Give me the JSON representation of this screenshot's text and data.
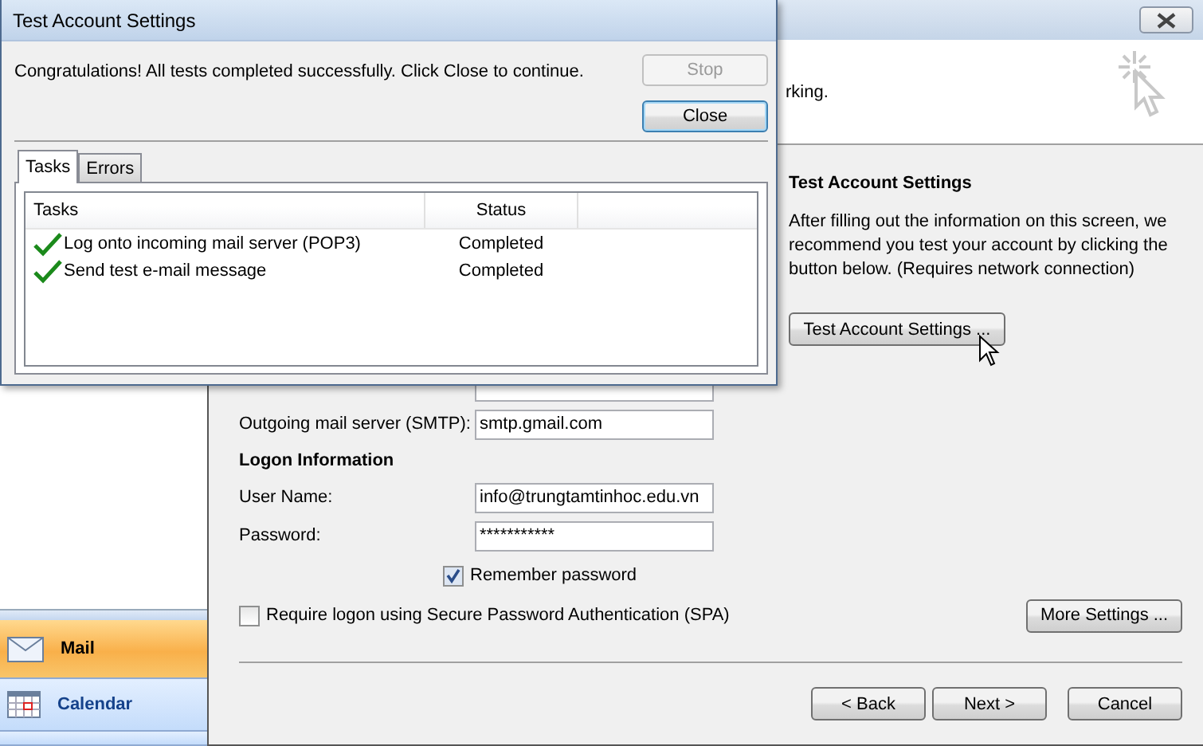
{
  "dialog": {
    "title": "Test Account Settings",
    "message": "Congratulations! All tests completed successfully. Click Close to continue.",
    "buttons": [
      {
        "label": "Stop",
        "disabled": true
      },
      {
        "label": "Close",
        "disabled": false
      }
    ],
    "tabs": [
      {
        "label": "Tasks",
        "selected": true
      },
      {
        "label": "Errors",
        "selected": false
      }
    ],
    "table": {
      "columns": [
        "Tasks",
        "Status"
      ],
      "rows": [
        {
          "task": "Log onto incoming mail server (POP3)",
          "status": "Completed",
          "done": true
        },
        {
          "task": "Send test e-mail message",
          "status": "Completed",
          "done": true
        }
      ]
    }
  },
  "wizard": {
    "header_text": "rking.",
    "section_title": "Test Account Settings",
    "description": "After filling out the information on this screen, we recommend you test your account by clicking the button below. (Requires network connection)",
    "test_button": "Test Account Settings ...",
    "server_fields": [
      {
        "label": "Outgoing mail server (SMTP):",
        "value": "smtp.gmail.com"
      }
    ],
    "logon_title": "Logon Information",
    "logon_fields": [
      {
        "label": "User Name:",
        "value": "info@trungtamtinhoc.edu.vn"
      },
      {
        "label": "Password:",
        "value": "***********"
      }
    ],
    "remember": {
      "label": "Remember password",
      "checked": true
    },
    "spa": {
      "label": "Require logon using Secure Password Authentication (SPA)",
      "checked": false
    },
    "more_button": "More Settings ...",
    "nav_buttons": [
      "< Back",
      "Next >",
      "Cancel"
    ]
  },
  "nav": [
    {
      "label": "Mail",
      "selected": true,
      "kind": "mail"
    },
    {
      "label": "Calendar",
      "selected": false,
      "kind": "calendar"
    }
  ]
}
